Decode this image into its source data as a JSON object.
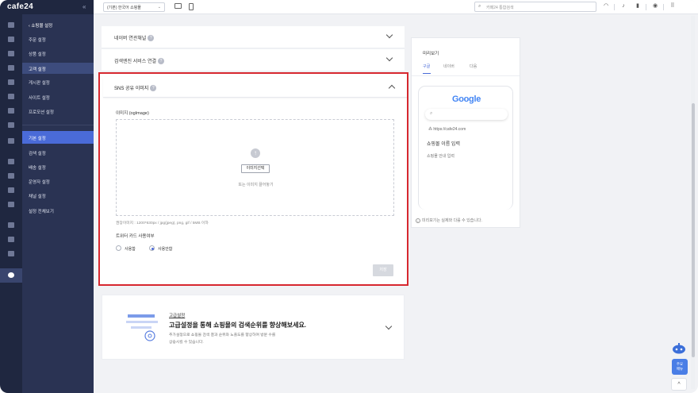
{
  "brand": {
    "logo": "cafe24",
    "collapse_icon": "double-chevron-left"
  },
  "topbar": {
    "shop_select": "(기본) 한국어 쇼핑몰",
    "search_placeholder": "카페24 통합검색"
  },
  "sidebar": {
    "header": "쇼핑몰 설정",
    "items_top": [
      "주문 설정",
      "상품 설정",
      "고객 설정",
      "게시판 설정",
      "사이트 설정",
      "프로모션 설정"
    ],
    "items_bottom": [
      "기본 설정",
      "검색 설정",
      "배송 설정",
      "운영자 설정",
      "채널 설정",
      "설정 전체보기"
    ],
    "selected_top": "고객 설정",
    "current": "기본 설정"
  },
  "accordion": {
    "naver_title": "네이버 연관채널",
    "search_engine_title": "검색엔진 서비스 연결",
    "sns_title": "SNS 공유 이미지"
  },
  "sns": {
    "og_label": "이미지 (ogImage)",
    "choose_button": "이미지선택",
    "drag_text": "또는 이미지 끌어놓기",
    "recommend": "권장이미지 : 1200*630px / jpg(jpeg), png, gif / 5MB 이하",
    "twitter_label": "트위터 카드 사용여부",
    "radio_on_label": "사용함",
    "radio_off_label": "사용안함",
    "apply_button": "저장"
  },
  "advanced": {
    "link": "고급설정",
    "title": "고급설정을 통해 쇼핑몰의 검색순위를 향상해보세요.",
    "desc_line1": "추가설정으로 쇼핑몰 검색 결과 순위와 노출도를 향상하여 방문 수를",
    "desc_line2": "상승시킬 수 있습니다."
  },
  "preview": {
    "title": "미리보기",
    "tabs": [
      "구글",
      "네이버",
      "다음"
    ],
    "google_logo": "Google",
    "url": "https://cafe24.com",
    "shop_name": "쇼핑몰 이름 입력",
    "shop_desc": "쇼핑몰 안내 입력",
    "note": "미리보기는 실제와 다를 수 있습니다."
  },
  "widgets": {
    "faq": [
      "주요",
      "메뉴"
    ],
    "top_button": "^"
  },
  "colors": {
    "accent": "#4a6bd8",
    "highlight_border": "#d7282f",
    "sidebar": "#2a3353"
  }
}
